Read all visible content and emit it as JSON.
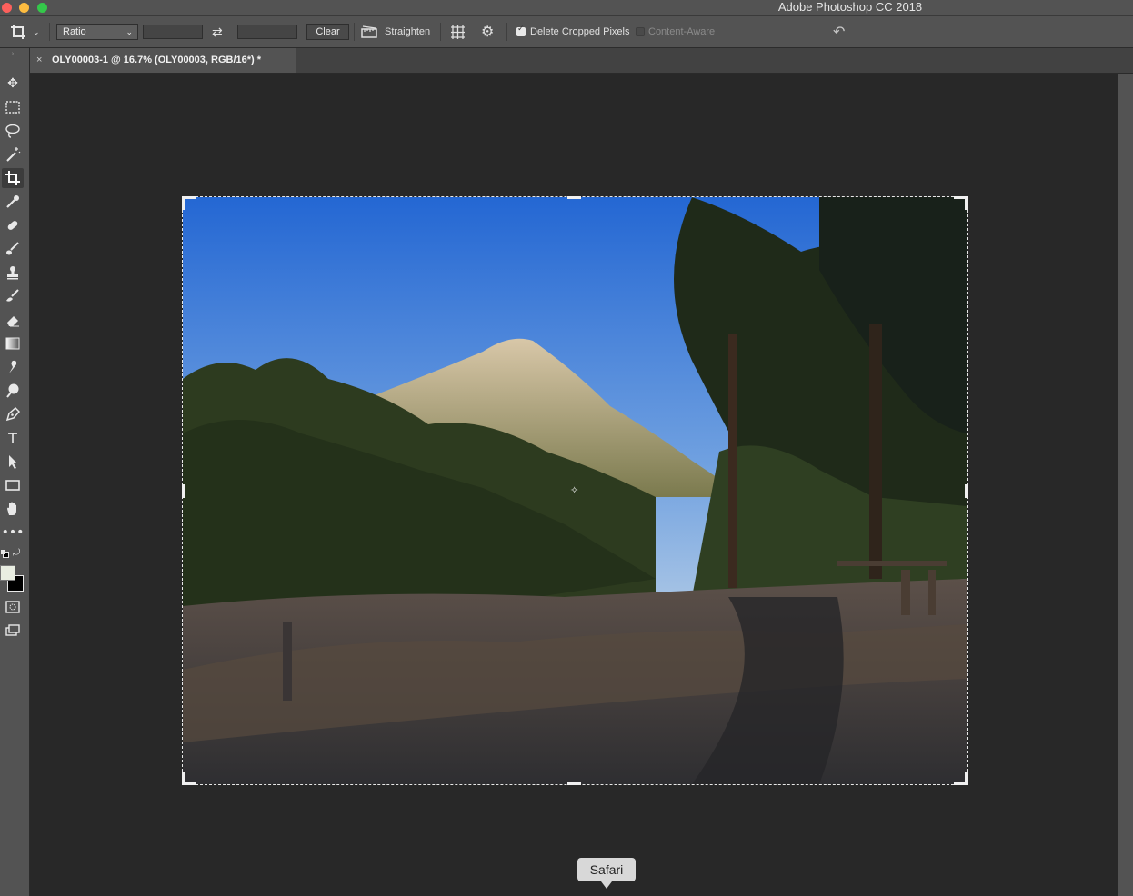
{
  "app": {
    "title": "Adobe Photoshop CC 2018"
  },
  "options_bar": {
    "ratio_value": "Ratio",
    "width_value": "",
    "height_value": "",
    "clear_label": "Clear",
    "straighten_label": "Straighten",
    "delete_cropped_label": "Delete Cropped Pixels",
    "delete_cropped_checked": true,
    "content_aware_label": "Content-Aware",
    "content_aware_checked": false
  },
  "document": {
    "tab_label": "OLY00003-1 @ 16.7% (OLY00003, RGB/16*) *",
    "close_glyph": "×",
    "image_description_icon": "landscape-photo"
  },
  "tools": [
    "move-icon",
    "marquee-icon",
    "lasso-icon",
    "magic-wand-icon",
    "crop-icon",
    "eyedropper-icon",
    "healing-brush-icon",
    "brush-icon",
    "clone-stamp-icon",
    "history-brush-icon",
    "eraser-icon",
    "gradient-icon",
    "smudge-icon",
    "dodge-icon",
    "pen-icon",
    "type-icon",
    "path-selection-icon",
    "rectangle-icon",
    "hand-icon",
    "more-tools-icon",
    "quick-mask-icon",
    "screen-mode-icon"
  ],
  "colors": {
    "foreground": "#e9eee2",
    "background": "#000000",
    "ui_panel": "#535353",
    "canvas": "#282828"
  },
  "tooltip": {
    "label": "Safari"
  }
}
